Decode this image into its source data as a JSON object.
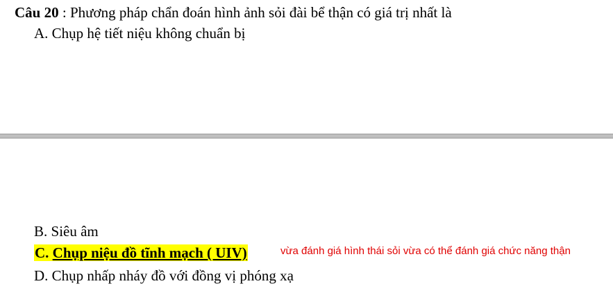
{
  "question": {
    "number_label": "Câu 20",
    "separator": " : ",
    "text": "Phương  pháp chẩn đoán hình ảnh sỏi đài bể thận có giá trị nhất là"
  },
  "options": {
    "a": {
      "letter": "A.",
      "text": "Chụp hệ tiết niệu không chuẩn bị"
    },
    "b": {
      "letter": "B.",
      "text": "Siêu âm"
    },
    "c": {
      "letter": "C.",
      "text": "Chụp niệu đồ tĩnh mạch ( UIV)"
    },
    "d": {
      "letter": "D.",
      "text": "Chụp nhấp nháy đồ với đồng vị phóng xạ"
    }
  },
  "explanation": "vừa đánh giá hình thái sỏi vừa có thể đánh giá chức năng thận",
  "colors": {
    "highlight": "#ffff00",
    "explanation_text": "#e00000",
    "divider": "#bfbfbf"
  }
}
